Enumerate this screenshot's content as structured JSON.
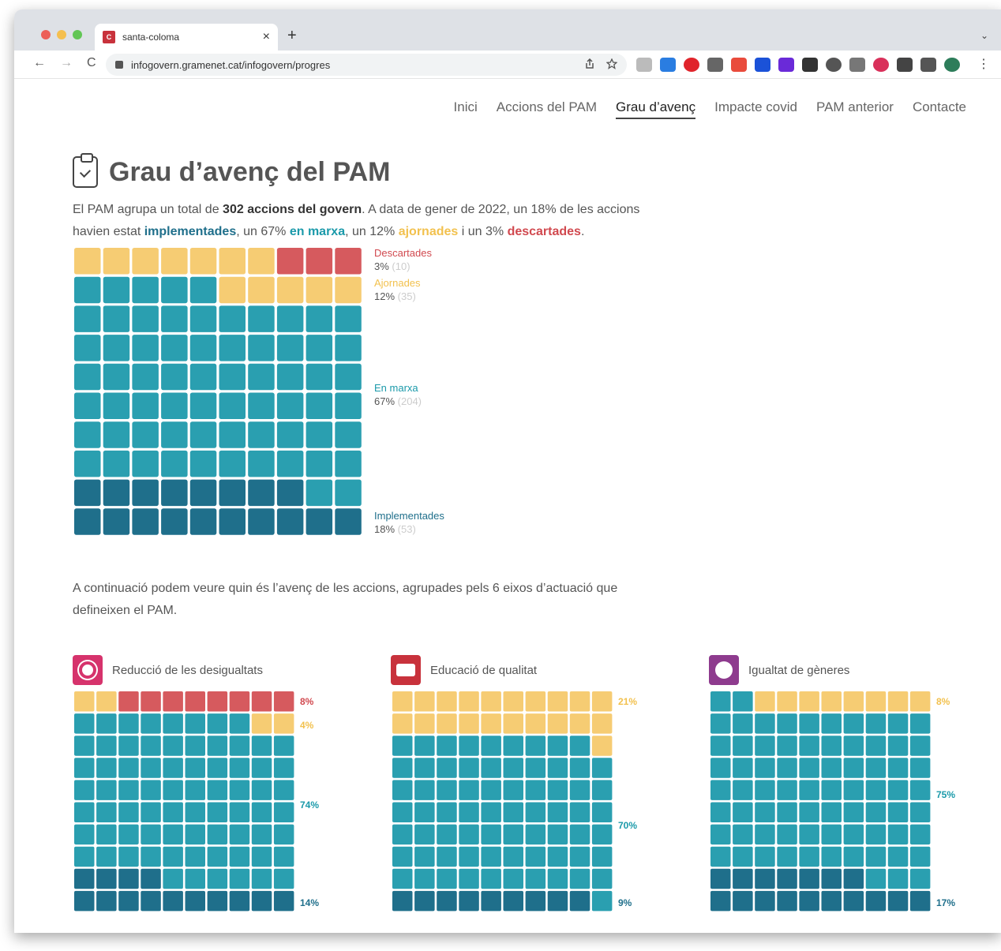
{
  "browser": {
    "tab_title": "santa-coloma",
    "favicon_text": "C",
    "url": "infogovern.gramenet.cat/infogovern/progres",
    "new_tab": "+",
    "close_tab": "×",
    "tab_menu": "⌄",
    "back": "←",
    "forward": "→",
    "reload": "C",
    "share_icon": "share-icon",
    "star_icon": "star-icon",
    "more": "⋮"
  },
  "nav": {
    "items": [
      "Inici",
      "Accions del PAM",
      "Grau d’avenç",
      "Impacte covid",
      "PAM anterior",
      "Contacte"
    ],
    "active": "Grau d’avenç"
  },
  "page": {
    "title": "Grau d’avenç del PAM",
    "intro": {
      "p1": "El PAM agrupa un total de ",
      "total": "302 accions del govern",
      "p2": ". A data de gener de 2022, un 18% de les accions havien estat ",
      "impl": "implementades",
      "p3": ", un 67% ",
      "marxa": "en marxa",
      "p4": ", un 12% ",
      "ajor": "ajornades",
      "p5": " i un 3% ",
      "desc": "descartades",
      "p6": "."
    },
    "para2": "A continuació podem veure quin és l’avenç de les accions, agrupades pels 6 eixos d’actuació que defineixen el PAM."
  },
  "colors": {
    "implementades": "#1f6f8b",
    "en_marxa": "#2a9fb0",
    "ajornades": "#f6cc73",
    "descartades": "#d65a5e"
  },
  "chart_data": [
    {
      "type": "waffle",
      "title": "",
      "grid": [
        10,
        10
      ],
      "categories": [
        "Implementades",
        "En marxa",
        "Ajornades",
        "Descartades"
      ],
      "values": [
        18,
        67,
        12,
        3
      ],
      "counts": [
        53,
        204,
        35,
        10
      ],
      "labels": {
        "impl": {
          "name": "Implementades",
          "pct": "18%",
          "count": "(53)"
        },
        "marxa": {
          "name": "En marxa",
          "pct": "67%",
          "count": "(204)"
        },
        "ajor": {
          "name": "Ajornades",
          "pct": "12%",
          "count": "(35)"
        },
        "desc": {
          "name": "Descartades",
          "pct": "3%",
          "count": "(10)"
        }
      }
    },
    {
      "type": "waffle",
      "title": "Reducció de les desigualtats",
      "grid": [
        10,
        10
      ],
      "categories": [
        "Implementades",
        "En marxa",
        "Ajornades",
        "Descartades"
      ],
      "values": [
        14,
        74,
        4,
        8
      ],
      "pct_labels": {
        "desc": "8%",
        "ajor": "4%",
        "marxa": "74%",
        "impl": "14%"
      }
    },
    {
      "type": "waffle",
      "title": "Educació de qualitat",
      "grid": [
        10,
        10
      ],
      "categories": [
        "Implementades",
        "En marxa",
        "Ajornades",
        "Descartades"
      ],
      "values": [
        9,
        70,
        21,
        0
      ],
      "pct_labels": {
        "ajor": "21%",
        "marxa": "70%",
        "impl": "9%"
      }
    },
    {
      "type": "waffle",
      "title": "Igualtat de gèneres",
      "grid": [
        10,
        10
      ],
      "categories": [
        "Implementades",
        "En marxa",
        "Ajornades",
        "Descartades"
      ],
      "values": [
        17,
        75,
        8,
        0
      ],
      "pct_labels": {
        "ajor": "8%",
        "marxa": "75%",
        "impl": "17%"
      }
    }
  ],
  "eixos_icons": {
    "e1": {
      "icon": "inequality-icon",
      "color": "#d6336c"
    },
    "e2": {
      "icon": "education-icon",
      "color": "#c8323c"
    },
    "e3": {
      "icon": "gender-equality-icon",
      "color": "#8e3b8e"
    }
  }
}
